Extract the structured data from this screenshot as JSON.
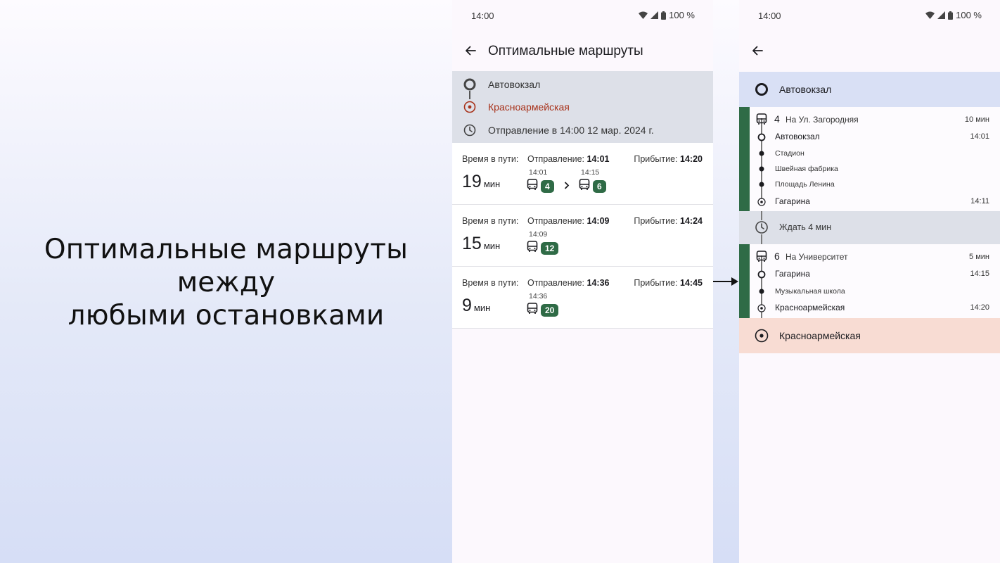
{
  "promo": {
    "line1": "Оптимальные маршруты",
    "line2": "между",
    "line3": "любыми остановками"
  },
  "status": {
    "time": "14:00",
    "battery": "100 %"
  },
  "screen1": {
    "title": "Оптимальные маршруты",
    "from": "Автовокзал",
    "to": "Красноармейская",
    "departure": "Отправление в 14:00 12 мар. 2024 г.",
    "labels": {
      "travel_time": "Время в пути:",
      "departure": "Отправление:",
      "arrival": "Прибытие:",
      "minutes": "мин"
    },
    "routes": [
      {
        "duration": "19",
        "departure": "14:01",
        "arrival": "14:20",
        "legs": [
          {
            "time": "14:01",
            "route": "4"
          },
          {
            "time": "14:15",
            "route": "6"
          }
        ]
      },
      {
        "duration": "15",
        "departure": "14:09",
        "arrival": "14:24",
        "legs": [
          {
            "time": "14:09",
            "route": "12"
          }
        ]
      },
      {
        "duration": "9",
        "departure": "14:36",
        "arrival": "14:45",
        "legs": [
          {
            "time": "14:36",
            "route": "20"
          }
        ]
      }
    ]
  },
  "screen2": {
    "start": "Автовокзал",
    "end": "Красноармейская",
    "legs": [
      {
        "route": "4",
        "direction": "На Ул. Загородняя",
        "duration": "10 мин",
        "stops": [
          {
            "name": "Автовокзал",
            "time": "14:01",
            "type": "board"
          },
          {
            "name": "Стадион",
            "time": "",
            "type": "pass"
          },
          {
            "name": "Швейная фабрика",
            "time": "",
            "type": "pass"
          },
          {
            "name": "Площадь Ленина",
            "time": "",
            "type": "pass"
          },
          {
            "name": "Гагарина",
            "time": "14:11",
            "type": "alight"
          }
        ]
      },
      {
        "route": "6",
        "direction": "На Университет",
        "duration": "5 мин",
        "stops": [
          {
            "name": "Гагарина",
            "time": "14:15",
            "type": "board"
          },
          {
            "name": "Музыкальная школа",
            "time": "",
            "type": "pass"
          },
          {
            "name": "Красноармейская",
            "time": "14:20",
            "type": "alight"
          }
        ]
      }
    ],
    "wait": "Ждать 4 мин"
  },
  "colors": {
    "route_badge": "#2f6b46",
    "destination_text": "#a8321a",
    "start_bg": "#d9e0f5",
    "end_bg": "#f8dcd3",
    "search_bg": "#dde0e8"
  }
}
